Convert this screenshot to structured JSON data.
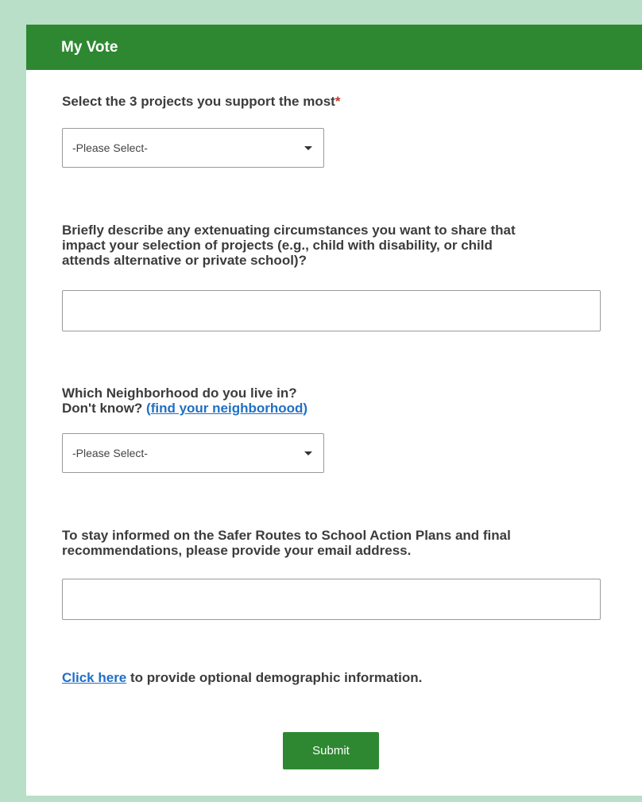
{
  "form": {
    "title": "My Vote",
    "q1": {
      "label": "Select the 3 projects you support the most",
      "required_mark": "*",
      "select_value": "-Please Select-"
    },
    "q2": {
      "line1": "Briefly describe any extenuating circumstances you want to share that",
      "line2": "impact your selection of projects (e.g., child with disability, or child",
      "line3": "attends alternative or private school)?",
      "value": ""
    },
    "q3": {
      "line1": "Which Neighborhood do you live in?",
      "line2_prefix": "Don't know? ",
      "link_open": "(",
      "link_text": "find your neighborhood",
      "link_close": ")",
      "select_value": "-Please Select-"
    },
    "q4": {
      "line1": "To stay informed on the Safer Routes to School Action Plans and final",
      "line2": "recommendations, please provide your email address.",
      "value": ""
    },
    "demographic": {
      "link_text": "Click here",
      "suffix": " to provide optional demographic information."
    },
    "submit_label": "Submit"
  },
  "colors": {
    "background": "#b9dfc9",
    "header": "#2e8832",
    "button": "#2e8832",
    "link": "#1f6fc5",
    "required": "#c0392b"
  }
}
